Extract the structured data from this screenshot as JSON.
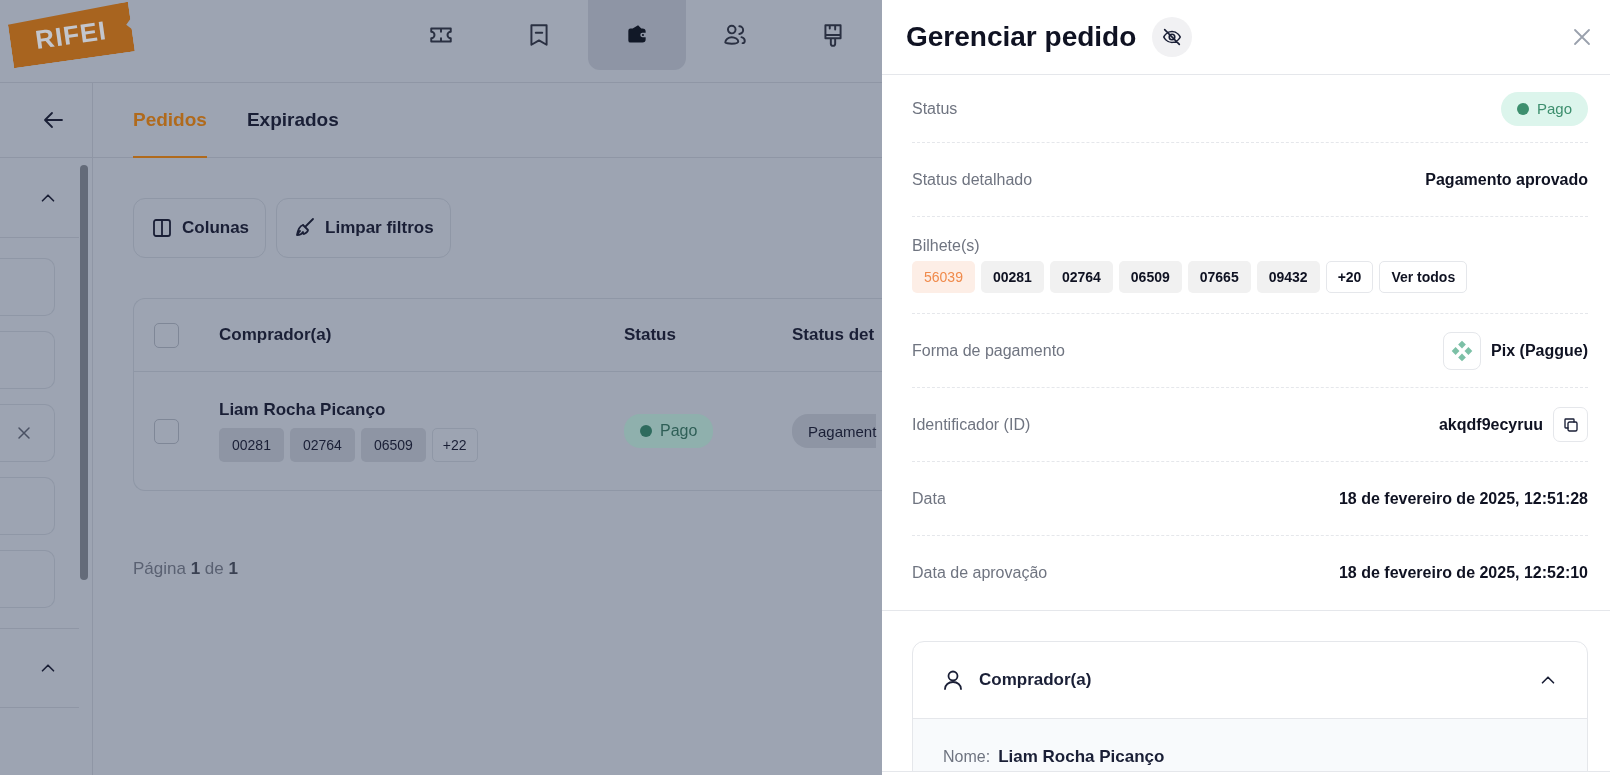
{
  "header": {
    "logo": "RIFEI",
    "nav": [
      {
        "kind": "ticket",
        "selected": false
      },
      {
        "kind": "receipt",
        "selected": false
      },
      {
        "kind": "wallet",
        "selected": true
      },
      {
        "kind": "users",
        "selected": false
      },
      {
        "kind": "brush",
        "selected": false
      }
    ]
  },
  "sidebar": {
    "sections": [
      {
        "expanded": true,
        "fields": [
          {
            "clearable": false
          },
          {
            "clearable": false
          },
          {
            "clearable": true
          },
          {
            "clearable": false
          },
          {
            "clearable": false
          }
        ]
      },
      {
        "expanded": true
      }
    ]
  },
  "tabs": [
    {
      "label": "Pedidos",
      "selected": true
    },
    {
      "label": "Expirados",
      "selected": false
    }
  ],
  "toolbar": [
    {
      "kind": "columns",
      "label": "Colunas"
    },
    {
      "kind": "clear",
      "label": "Limpar filtros"
    }
  ],
  "table": {
    "select_all_checked": false,
    "columns": [
      "Comprador(a)",
      "Status",
      "Status det"
    ],
    "rows": [
      {
        "checked": false,
        "buyer": "Liam Rocha Picanço",
        "tickets": [
          "00281",
          "02764",
          "06509"
        ],
        "more": "+22",
        "status": "Pago",
        "status_detail": "Pagament"
      }
    ]
  },
  "pagination": "Página **1** de **1**",
  "drawer": {
    "title": "Gerenciar pedido",
    "fields": [
      {
        "kind": "badge",
        "label": "Status",
        "value": "Pago"
      },
      {
        "kind": "text",
        "label": "Status detalhado",
        "value": "Pagamento aprovado"
      },
      {
        "kind": "tickets",
        "label": "Bilhete(s)",
        "tickets": [
          {
            "number": "56039",
            "highlighted": true
          },
          {
            "number": "00281",
            "highlighted": false
          },
          {
            "number": "02764",
            "highlighted": false
          },
          {
            "number": "06509",
            "highlighted": false
          },
          {
            "number": "07665",
            "highlighted": false
          },
          {
            "number": "09432",
            "highlighted": false
          }
        ],
        "more": "+20",
        "action": "Ver todos"
      },
      {
        "kind": "payment",
        "label": "Forma de pagamento",
        "value": "Pix (Paggue)"
      },
      {
        "kind": "copy",
        "label": "Identificador (ID)",
        "value": "akqdf9ecyruu"
      },
      {
        "kind": "text",
        "label": "Data",
        "value": "18 de fevereiro de 2025, 12:51:28"
      },
      {
        "kind": "text",
        "label": "Data de aprovação",
        "value": "18 de fevereiro de 2025, 12:52:10"
      }
    ],
    "buyer_section": {
      "title": "Comprador(a)",
      "expanded": true,
      "fields": [
        {
          "label": "Nome:",
          "value": "Liam Rocha Picanço"
        }
      ]
    }
  }
}
